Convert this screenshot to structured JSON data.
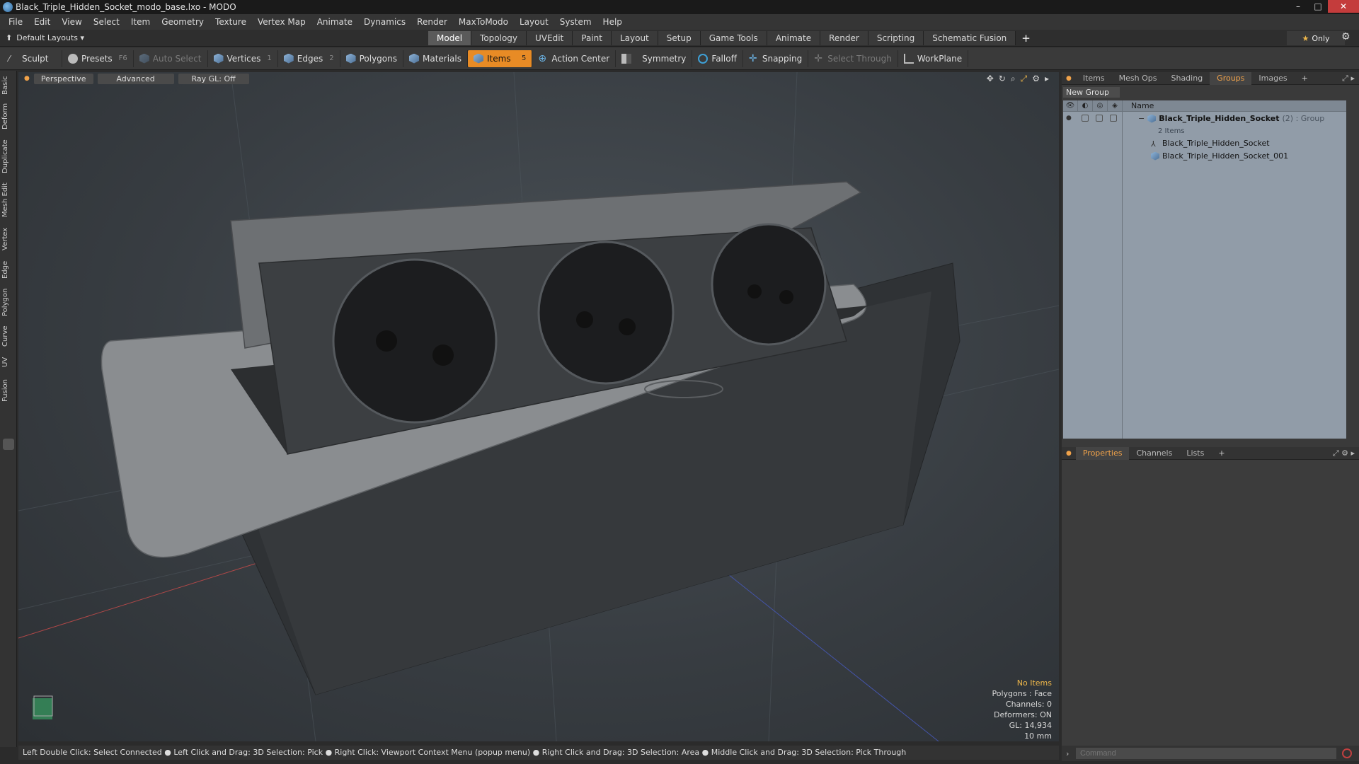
{
  "window": {
    "title": "Black_Triple_Hidden_Socket_modo_base.lxo - MODO",
    "min": "–",
    "max": "□",
    "close": "✕"
  },
  "menu": [
    "File",
    "Edit",
    "View",
    "Select",
    "Item",
    "Geometry",
    "Texture",
    "Vertex Map",
    "Animate",
    "Dynamics",
    "Render",
    "MaxToModo",
    "Layout",
    "System",
    "Help"
  ],
  "modebar": {
    "layout_label": "Default Layouts ▾",
    "tabs": [
      "Model",
      "Topology",
      "UVEdit",
      "Paint",
      "Layout",
      "Setup",
      "Game Tools",
      "Animate",
      "Render",
      "Scripting",
      "Schematic Fusion"
    ],
    "active_tab": "Model",
    "add": "+",
    "only_label": "Only"
  },
  "toolbar": {
    "sculpt": "Sculpt",
    "presets": "Presets",
    "presets_key": "F6",
    "auto_select": "Auto Select",
    "vertices": "Vertices",
    "vertices_key": "1",
    "edges": "Edges",
    "edges_key": "2",
    "polygons": "Polygons",
    "materials": "Materials",
    "items": "Items",
    "items_key": "5",
    "action_center": "Action Center",
    "symmetry": "Symmetry",
    "falloff": "Falloff",
    "snapping": "Snapping",
    "select_through": "Select Through",
    "workplane": "WorkPlane"
  },
  "left_tabs": [
    "Basic",
    "Deform",
    "Duplicate",
    "Mesh Edit",
    "Vertex",
    "Edge",
    "Polygon",
    "Curve",
    "UV",
    "Fusion"
  ],
  "viewport": {
    "view": "Perspective",
    "shading": "Advanced",
    "raygl": "Ray GL: Off",
    "info": {
      "no_items": "No Items",
      "polygons": "Polygons : Face",
      "channels": "Channels: 0",
      "deformers": "Deformers: ON",
      "gl": "GL: 14,934",
      "unit": "10 mm"
    }
  },
  "status": "Left Double Click: Select Connected ● Left Click and Drag: 3D Selection: Pick ● Right Click: Viewport Context Menu (popup menu) ● Right Click and Drag: 3D Selection: Area ● Middle Click and Drag: 3D Selection: Pick Through",
  "groups_panel": {
    "tabs": [
      "Items",
      "Mesh Ops",
      "Shading",
      "Groups",
      "Images"
    ],
    "active_tab": "Groups",
    "add": "+",
    "new_group": "New Group",
    "name_header": "Name",
    "group": {
      "name": "Black_Triple_Hidden_Socket",
      "meta": "(2) : Group",
      "count": "2 Items",
      "children": [
        "Black_Triple_Hidden_Socket",
        "Black_Triple_Hidden_Socket_001"
      ]
    }
  },
  "props_panel": {
    "tabs": [
      "Properties",
      "Channels",
      "Lists"
    ],
    "active_tab": "Properties",
    "add": "+"
  },
  "command": {
    "placeholder": "Command"
  },
  "colors": {
    "accent": "#e88b25",
    "tab_active_text": "#f0a24a",
    "table_bg": "#919ca8"
  }
}
